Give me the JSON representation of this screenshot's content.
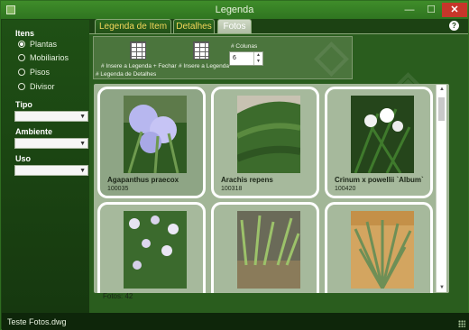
{
  "window": {
    "title": "Legenda"
  },
  "window_controls": {
    "minimize": "—",
    "maximize": "☐",
    "close": "✕"
  },
  "help": "?",
  "sidebar": {
    "itens_label": "Itens",
    "radios": [
      {
        "label": "Plantas",
        "selected": true
      },
      {
        "label": "Mobiliarios",
        "selected": false
      },
      {
        "label": "Pisos",
        "selected": false
      },
      {
        "label": "Divisor",
        "selected": false
      }
    ],
    "tipo_label": "Tipo",
    "ambiente_label": "Ambiente",
    "uso_label": "Uso"
  },
  "tabs": [
    {
      "label": "Legenda de Item",
      "active": false
    },
    {
      "label": "Detalhes",
      "active": false
    },
    {
      "label": "Fotos",
      "active": true
    }
  ],
  "ribbon": {
    "insert_close_label": "# Insere a Legenda + Fechar",
    "insert_label": "# Insere a Legenda",
    "columns_label": "# Colunas",
    "columns_value": "6",
    "group_label": "# Legenda de Detalhes"
  },
  "gallery": {
    "cards": [
      {
        "name": "Agapanthus praecox",
        "code": "100035",
        "selected": true
      },
      {
        "name": "Arachis repens",
        "code": "100318",
        "selected": false
      },
      {
        "name": "Crinum x powellii `Album`",
        "code": "100420",
        "selected": false
      },
      {
        "name": "",
        "code": "",
        "selected": false
      },
      {
        "name": "",
        "code": "",
        "selected": false
      },
      {
        "name": "",
        "code": "",
        "selected": false
      }
    ],
    "count_text": "Fotos: 42"
  },
  "status": {
    "file": "Teste Fotos.dwg"
  },
  "colors": {
    "accent_tab_text": "#f3d85a",
    "background": "#1d4514",
    "card_border": "#ffffff",
    "close_button": "#c7362a"
  }
}
